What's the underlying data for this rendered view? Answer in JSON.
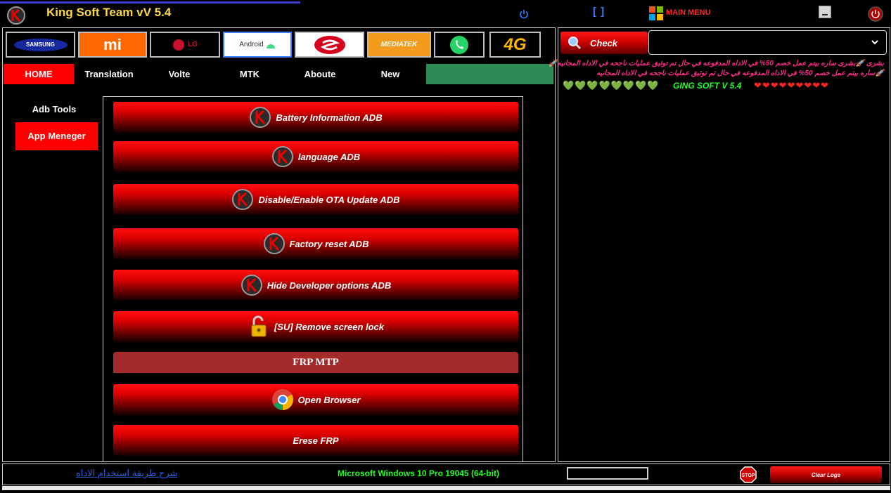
{
  "window": {
    "title": "King Soft Team vV 5.4",
    "brackets": "[ ]",
    "main_menu": "MAIN MENU"
  },
  "brands": [
    {
      "label": "SAMSUNG",
      "bg": "#000000",
      "fg": "#ffffff"
    },
    {
      "label": "mi",
      "bg": "#ff6700",
      "fg": "#ffffff"
    },
    {
      "label": "LG",
      "bg": "#000000",
      "fg": "#c8102e"
    },
    {
      "label": "Android",
      "bg": "#ffffff",
      "fg": "#333333"
    },
    {
      "label": "snapdragon",
      "bg": "#ffffff",
      "fg": "#d6001c"
    },
    {
      "label": "MEDIATEK",
      "bg": "#f29b1d",
      "fg": "#ffffff"
    },
    {
      "label": "whatsapp",
      "bg": "#000000",
      "fg": "#25d366"
    },
    {
      "label": "4G",
      "bg": "#000000",
      "fg": "#ffb800"
    }
  ],
  "tabs": [
    {
      "label": "HOME",
      "active": true
    },
    {
      "label": "Translation"
    },
    {
      "label": "Volte"
    },
    {
      "label": "MTK"
    },
    {
      "label": "Aboute"
    },
    {
      "label": "New"
    }
  ],
  "sidebar": {
    "adb_tools": "Adb Tools",
    "app_manager": "App Meneger"
  },
  "actions": [
    {
      "label": "Battery Information ADB",
      "icon": "king-logo-icon"
    },
    {
      "label": "language ADB",
      "icon": "king-logo-icon"
    },
    {
      "label": "Disable/Enable OTA Update ADB",
      "icon": "king-logo-icon"
    },
    {
      "label": "Factory reset ADB",
      "icon": "king-logo-icon"
    },
    {
      "label": "Hide Developer options ADB",
      "icon": "king-logo-icon"
    },
    {
      "label": "[SU] Remove screen lock",
      "icon": "unlock-icon"
    }
  ],
  "frp": {
    "header": "FRP MTP",
    "open_browser": "Open Browser",
    "erase_frp": "Erese FRP"
  },
  "right": {
    "check_label": "Check",
    "dropdown_value": "",
    "log_line1": "بشرى 🚀بشرى ساره بيتم عمل خصم 50% في الاداه المدفوعه في حال تم توثيق عمليات ناجحه في الاداه المجانيه🚀",
    "log_line2": "🚀ساره بيتم عمل خصم 50% في الاداه المدفوعه في حال تم توثيق عمليات ناجحه في الاداه المجانيه",
    "green_hearts": "💚💚💚💚💚💚💚💚",
    "ging_text": "GING SOFT V 5.4",
    "red_hearts": "❤❤❤❤❤❤❤❤❤"
  },
  "bottom": {
    "tutorial_link": "شرح طريقة استخدام الاداه",
    "os_info": "Microsoft Windows 10 Pro 19045 (64-bit)",
    "stop_label": "STOP",
    "clear_logs": "Clear Logs"
  },
  "colors": {
    "accent_red": "#ff0000",
    "title_yellow": "#ffd84a",
    "green": "#22ff22",
    "pink": "#ff2a8a",
    "tab_green": "#2e8b57",
    "section_red": "#a52a2a"
  }
}
